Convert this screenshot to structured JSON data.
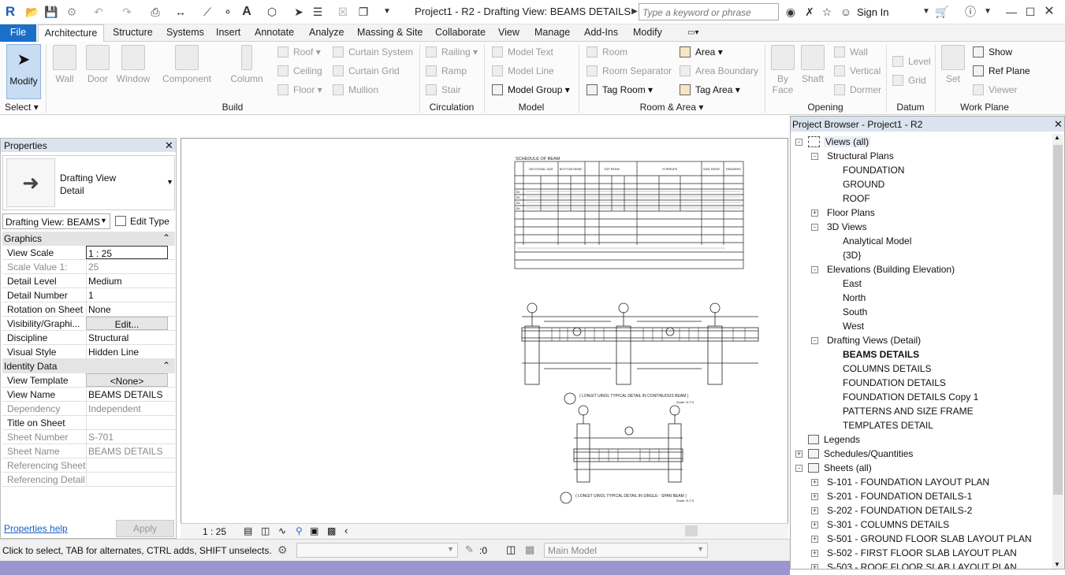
{
  "app": {
    "title": "Project1 - R2 - Drafting View: BEAMS DETAILS",
    "search_placeholder": "Type a keyword or phrase",
    "sign_in": "Sign In",
    "logo_letter": "R"
  },
  "tabs": [
    "File",
    "Architecture",
    "Structure",
    "Systems",
    "Insert",
    "Annotate",
    "Analyze",
    "Massing & Site",
    "Collaborate",
    "View",
    "Manage",
    "Add-Ins",
    "Modify"
  ],
  "ribbon": {
    "modify": "Modify",
    "select": "Select",
    "build_big": [
      "Wall",
      "Door",
      "Window",
      "Component",
      "Column"
    ],
    "build_small": [
      "Roof",
      "Ceiling",
      "Floor",
      "Curtain  System",
      "Curtain  Grid",
      "Mullion"
    ],
    "circulation": [
      "Railing",
      "Ramp",
      "Stair"
    ],
    "model": [
      "Model  Text",
      "Model  Line",
      "Model  Group"
    ],
    "room_area": [
      "Room",
      "Room  Separator",
      "Tag  Room",
      "Area",
      "Area  Boundary",
      "Tag  Area"
    ],
    "opening_big": [
      "By Face",
      "Shaft"
    ],
    "opening_small": [
      "Wall",
      "Vertical",
      "Dormer"
    ],
    "datum": [
      "Level",
      "Grid"
    ],
    "workplane_big": "Set",
    "workplane_small": [
      "Show",
      "Ref  Plane",
      "Viewer"
    ],
    "panels": [
      "Build",
      "Circulation",
      "Model",
      "Room & Area",
      "Opening",
      "Datum",
      "Work Plane"
    ]
  },
  "properties": {
    "title": "Properties",
    "type_name_1": "Drafting View",
    "type_name_2": "Detail",
    "selector": "Drafting View: BEAMS",
    "edit_type": "Edit Type",
    "group_graphics": "Graphics",
    "group_identity": "Identity Data",
    "rows_graphics": [
      {
        "k": "View Scale",
        "v": "1 : 25"
      },
      {
        "k": "Scale Value    1:",
        "v": "25"
      },
      {
        "k": "Detail Level",
        "v": "Medium"
      },
      {
        "k": "Detail Number",
        "v": "1"
      },
      {
        "k": "Rotation on Sheet",
        "v": "None"
      },
      {
        "k": "Visibility/Graphi...",
        "v": "Edit..."
      },
      {
        "k": "Discipline",
        "v": "Structural"
      },
      {
        "k": "Visual Style",
        "v": "Hidden Line"
      }
    ],
    "rows_identity": [
      {
        "k": "View Template",
        "v": "<None>"
      },
      {
        "k": "View Name",
        "v": "BEAMS DETAILS"
      },
      {
        "k": "Dependency",
        "v": "Independent"
      },
      {
        "k": "Title on Sheet",
        "v": ""
      },
      {
        "k": "Sheet Number",
        "v": "S-701"
      },
      {
        "k": "Sheet Name",
        "v": "BEAMS DETAILS"
      },
      {
        "k": "Referencing Sheet",
        "v": ""
      },
      {
        "k": "Referencing Detail",
        "v": ""
      }
    ],
    "help": "Properties help",
    "apply": "Apply"
  },
  "drawing": {
    "schedule_title": "SCHEDULE OF BEAM",
    "schedule_headers": [
      "SECTIONAL SIZE",
      "BOTTOM REINF.",
      "TOP REINF.",
      "STIRRUPS",
      "SIDE REINF.",
      "REMARKS"
    ],
    "schedule_rows": [
      "B1",
      "B2",
      "B3",
      "B4"
    ],
    "caption_1": "( LONGIT UINOL TYPICAL DETAIL IN CONTINUOUS BEAM )",
    "caption_2": "( LONGIT UINOL TYPICAL DETAIL IN SINGLE - SPAN BEAM )",
    "scale_note": "Scale: N.T.S."
  },
  "viewbar": {
    "scale": "1 : 25"
  },
  "browser": {
    "title": "Project Browser - Project1 - R2",
    "nodes": [
      {
        "t": "Views (all)",
        "d": 0,
        "g": "-",
        "boxed": true
      },
      {
        "t": "Structural Plans",
        "d": 1,
        "g": "-"
      },
      {
        "t": "FOUNDATION",
        "d": 2
      },
      {
        "t": "GROUND",
        "d": 2
      },
      {
        "t": "ROOF",
        "d": 2
      },
      {
        "t": "Floor Plans",
        "d": 1,
        "g": "+"
      },
      {
        "t": "3D Views",
        "d": 1,
        "g": "-"
      },
      {
        "t": "Analytical Model",
        "d": 2
      },
      {
        "t": "{3D}",
        "d": 2
      },
      {
        "t": "Elevations (Building Elevation)",
        "d": 1,
        "g": "-"
      },
      {
        "t": "East",
        "d": 2
      },
      {
        "t": "North",
        "d": 2
      },
      {
        "t": "South",
        "d": 2
      },
      {
        "t": "West",
        "d": 2
      },
      {
        "t": "Drafting Views (Detail)",
        "d": 1,
        "g": "-"
      },
      {
        "t": "BEAMS DETAILS",
        "d": 2,
        "bold": true
      },
      {
        "t": "COLUMNS DETAILS",
        "d": 2
      },
      {
        "t": "FOUNDATION DETAILS",
        "d": 2
      },
      {
        "t": "FOUNDATION DETAILS Copy 1",
        "d": 2
      },
      {
        "t": "PATTERNS AND SIZE FRAME",
        "d": 2
      },
      {
        "t": "TEMPLATES DETAIL",
        "d": 2
      },
      {
        "t": "Legends",
        "d": 0,
        "icon": true
      },
      {
        "t": "Schedules/Quantities",
        "d": 0,
        "g": "+",
        "icon": true
      },
      {
        "t": "Sheets (all)",
        "d": 0,
        "g": "-",
        "icon": true
      },
      {
        "t": "S-101 - FOUNDATION LAYOUT PLAN",
        "d": 1,
        "g": "+"
      },
      {
        "t": "S-201 - FOUNDATION DETAILS-1",
        "d": 1,
        "g": "+"
      },
      {
        "t": "S-202 - FOUNDATION DETAILS-2",
        "d": 1,
        "g": "+"
      },
      {
        "t": "S-301 - COLUMNS DETAILS",
        "d": 1,
        "g": "+"
      },
      {
        "t": "S-501 - GROUND FLOOR SLAB LAYOUT PLAN",
        "d": 1,
        "g": "+"
      },
      {
        "t": "S-502 - FIRST FLOOR SLAB LAYOUT PLAN",
        "d": 1,
        "g": "+"
      },
      {
        "t": "S-503 - ROOF FLOOR SLAB LAYOUT PLAN",
        "d": 1,
        "g": "+"
      }
    ]
  },
  "status": {
    "hint": "Click to select, TAB for alternates, CTRL adds, SHIFT unselects.",
    "count": ":0",
    "model": "Main Model"
  },
  "colors": {
    "file_tab": "#1a6fc9",
    "panel_head": "#dbe3ee",
    "modify_active": "#c8dcf3",
    "bottom_band": "#9c95cf"
  }
}
